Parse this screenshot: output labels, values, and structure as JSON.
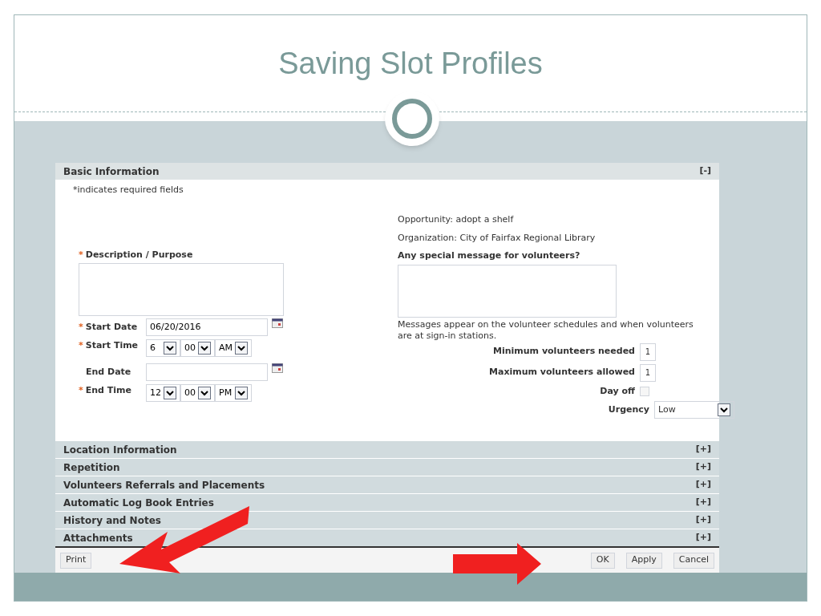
{
  "slide": {
    "title": "Saving Slot Profiles"
  },
  "basic": {
    "title": "Basic Information",
    "toggle": "[-]",
    "expanded": true,
    "required_note": "*indicates required fields",
    "description": {
      "marker": "*",
      "label": "Description / Purpose"
    },
    "start_date": {
      "marker": "*",
      "label": "Start Date",
      "value": "06/20/2016"
    },
    "start_time": {
      "marker": "*",
      "label": "Start Time",
      "hour": "6",
      "minute": "00",
      "ampm": "AM"
    },
    "end_date": {
      "label": "End Date"
    },
    "end_time": {
      "marker": "*",
      "label": "End Time",
      "hour": "12",
      "minute": "00",
      "ampm": "PM"
    },
    "opportunity": "Opportunity: adopt a shelf",
    "organization": "Organization: City of Fairfax Regional Library",
    "message_label": "Any special message for volunteers?",
    "message_help": "Messages appear on the volunteer schedules and when volunteers are at sign-in stations.",
    "min_label": "Minimum volunteers needed",
    "min_value": "1",
    "max_label": "Maximum volunteers allowed",
    "max_value": "1",
    "dayoff_label": "Day off",
    "dayoff_checked": false,
    "urgency_label": "Urgency",
    "urgency_value": "Low"
  },
  "sections": [
    {
      "title": "Location Information",
      "toggle": "[+]",
      "expanded": false
    },
    {
      "title": "Repetition",
      "toggle": "[+]",
      "expanded": false
    },
    {
      "title": "Volunteers Referrals and Placements",
      "toggle": "[+]",
      "expanded": false
    },
    {
      "title": "Automatic Log Book Entries",
      "toggle": "[+]",
      "expanded": false
    },
    {
      "title": "History and Notes",
      "toggle": "[+]",
      "expanded": false
    },
    {
      "title": "Attachments",
      "toggle": "[+]",
      "expanded": false
    }
  ],
  "footer": {
    "left_buttons": [
      "Print"
    ],
    "right_buttons": [
      "OK",
      "Apply",
      "Cancel"
    ]
  }
}
